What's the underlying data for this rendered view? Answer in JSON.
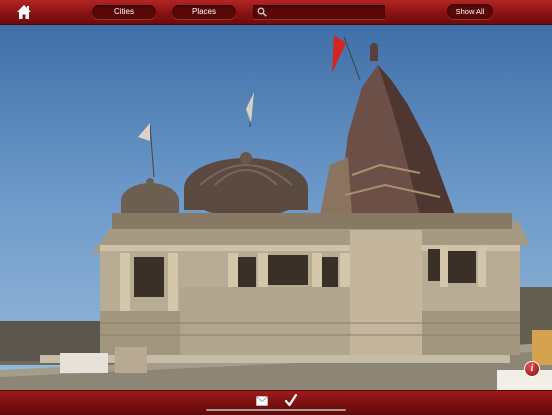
{
  "toolbar": {
    "home_icon": "home-icon",
    "cities_label": "Cities",
    "places_label": "Places",
    "search_icon": "search-icon",
    "search_value": "",
    "show_all_label": "Show All"
  },
  "photo": {
    "subject_icon": "temple-photo"
  },
  "bottom": {
    "mail_icon": "mail-icon",
    "check_icon": "check-icon",
    "info_icon": "info-icon",
    "info_label": "i"
  },
  "colors": {
    "bar_red": "#8a1212",
    "pill_dark": "#5a0808",
    "sky": "#6b98c8"
  }
}
